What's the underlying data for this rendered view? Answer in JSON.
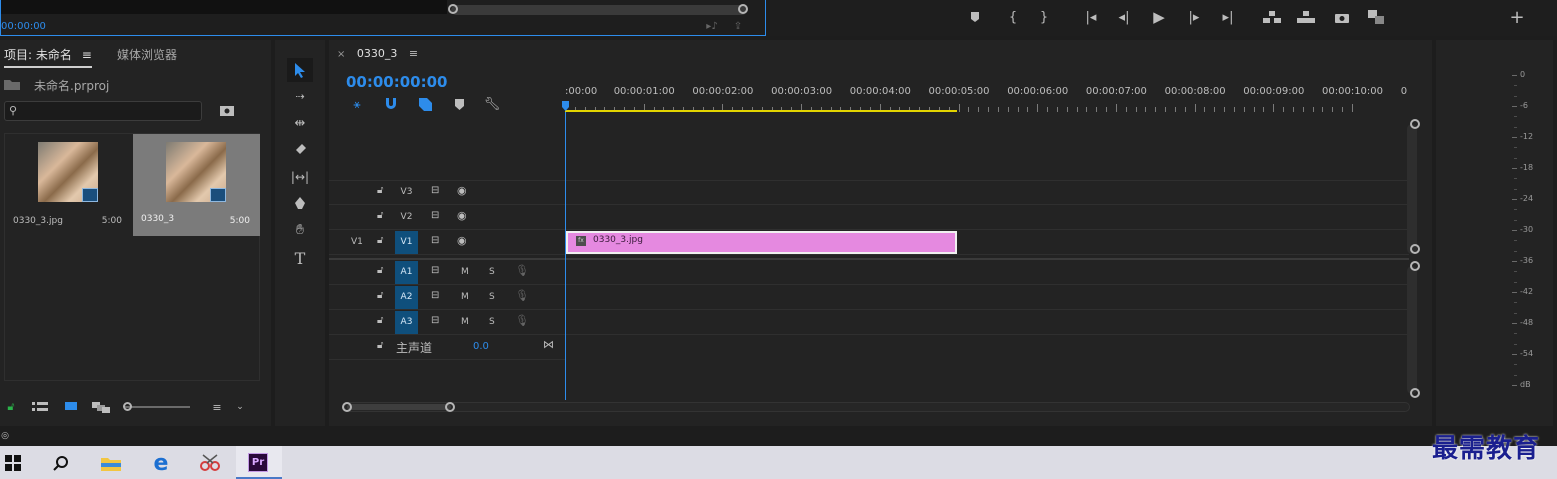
{
  "source_monitor": {
    "timecode": "00:00:00"
  },
  "program_controls": {
    "buttons": [
      "marker-icon",
      "mark-in-icon",
      "mark-out-icon",
      "go-to-in-icon",
      "step-back-icon",
      "play-icon",
      "step-forward-icon",
      "go-to-out-icon",
      "lift-icon",
      "extract-icon",
      "export-frame-icon",
      "compare-icon"
    ],
    "add_label": "+"
  },
  "project_panel": {
    "tab_label": "项目: 未命名",
    "tab2_label": "媒体浏览器",
    "project_file": "未命名.prproj",
    "search_placeholder": "",
    "items": [
      {
        "name": "0330_3.jpg",
        "duration": "5:00",
        "selected": false
      },
      {
        "name": "0330_3",
        "duration": "5:00",
        "selected": true
      }
    ]
  },
  "timeline": {
    "tab_close": "×",
    "sequence_name": "0330_3",
    "tab_menu": "≡",
    "timecode": "00:00:00:00",
    "ruler_labels": [
      ":00:00",
      "00:00:01:00",
      "00:00:02:00",
      "00:00:03:00",
      "00:00:04:00",
      "00:00:05:00",
      "00:00:06:00",
      "00:00:07:00",
      "00:00:08:00",
      "00:00:09:00",
      "00:00:10:00",
      "0"
    ],
    "video_tracks": [
      {
        "source": "",
        "name": "V3",
        "highlight": false
      },
      {
        "source": "",
        "name": "V2",
        "highlight": false
      },
      {
        "source": "V1",
        "name": "V1",
        "highlight": true
      }
    ],
    "audio_tracks": [
      {
        "name": "A1",
        "m": "M",
        "s": "S"
      },
      {
        "name": "A2",
        "m": "M",
        "s": "S"
      },
      {
        "name": "A3",
        "m": "M",
        "s": "S"
      }
    ],
    "master": {
      "label": "主声道",
      "value": "0.0"
    },
    "clip": {
      "name": "0330_3.jpg",
      "fx": "fx",
      "color": "#e589e0"
    }
  },
  "audio_meter": {
    "labels": [
      "0",
      "-6",
      "-12",
      "-18",
      "-24",
      "-30",
      "-36",
      "-42",
      "-48",
      "-54",
      "dB"
    ]
  },
  "taskbar": {
    "apps": [
      "windows-start-icon",
      "search-icon",
      "file-explorer-icon",
      "edge-icon",
      "snipping-tool-icon",
      "premiere-icon"
    ],
    "premiere_label": "Pr"
  },
  "watermark": "最需教育"
}
